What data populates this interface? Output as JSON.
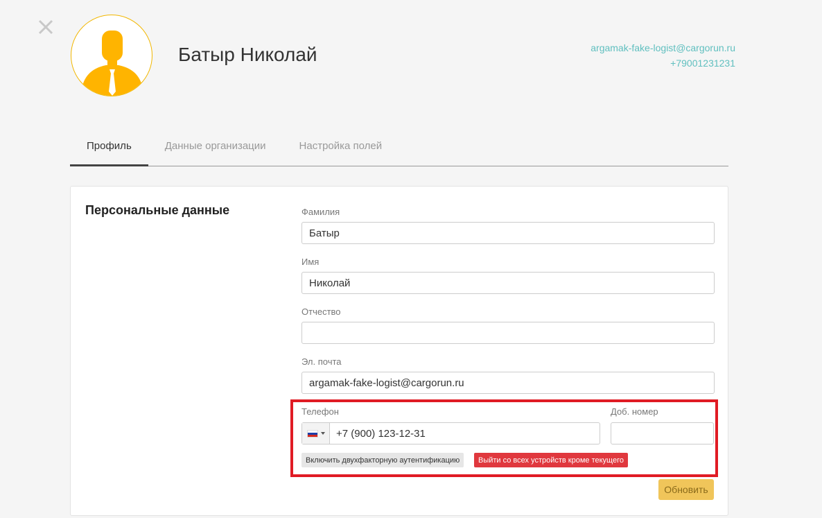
{
  "header": {
    "close_icon": "close-icon",
    "avatar_icon": "user-avatar-icon",
    "user_name": "Батыр Николай",
    "email": "argamak-fake-logist@cargorun.ru",
    "phone": "+79001231231",
    "accent_color": "#5fbfbf"
  },
  "tabs": [
    {
      "label": "Профиль",
      "active": true
    },
    {
      "label": "Данные организации",
      "active": false
    },
    {
      "label": "Настройка полей",
      "active": false
    }
  ],
  "form": {
    "section_title": "Персональные данные",
    "last_name": {
      "label": "Фамилия",
      "value": "Батыр"
    },
    "first_name": {
      "label": "Имя",
      "value": "Николай"
    },
    "middle_name": {
      "label": "Отчество",
      "value": ""
    },
    "email": {
      "label": "Эл. почта",
      "value": "argamak-fake-logist@cargorun.ru"
    },
    "phone": {
      "label": "Телефон",
      "value": "+7 (900) 123-12-31",
      "country_icon": "russia-flag-icon"
    },
    "ext": {
      "label": "Доб. номер",
      "value": ""
    },
    "two_factor_button": "Включить двухфакторную аутентификацию",
    "logout_all_button": "Выйти со всех устройств кроме текущего",
    "update_button": "Обновить",
    "highlight_color": "#e01b24"
  }
}
